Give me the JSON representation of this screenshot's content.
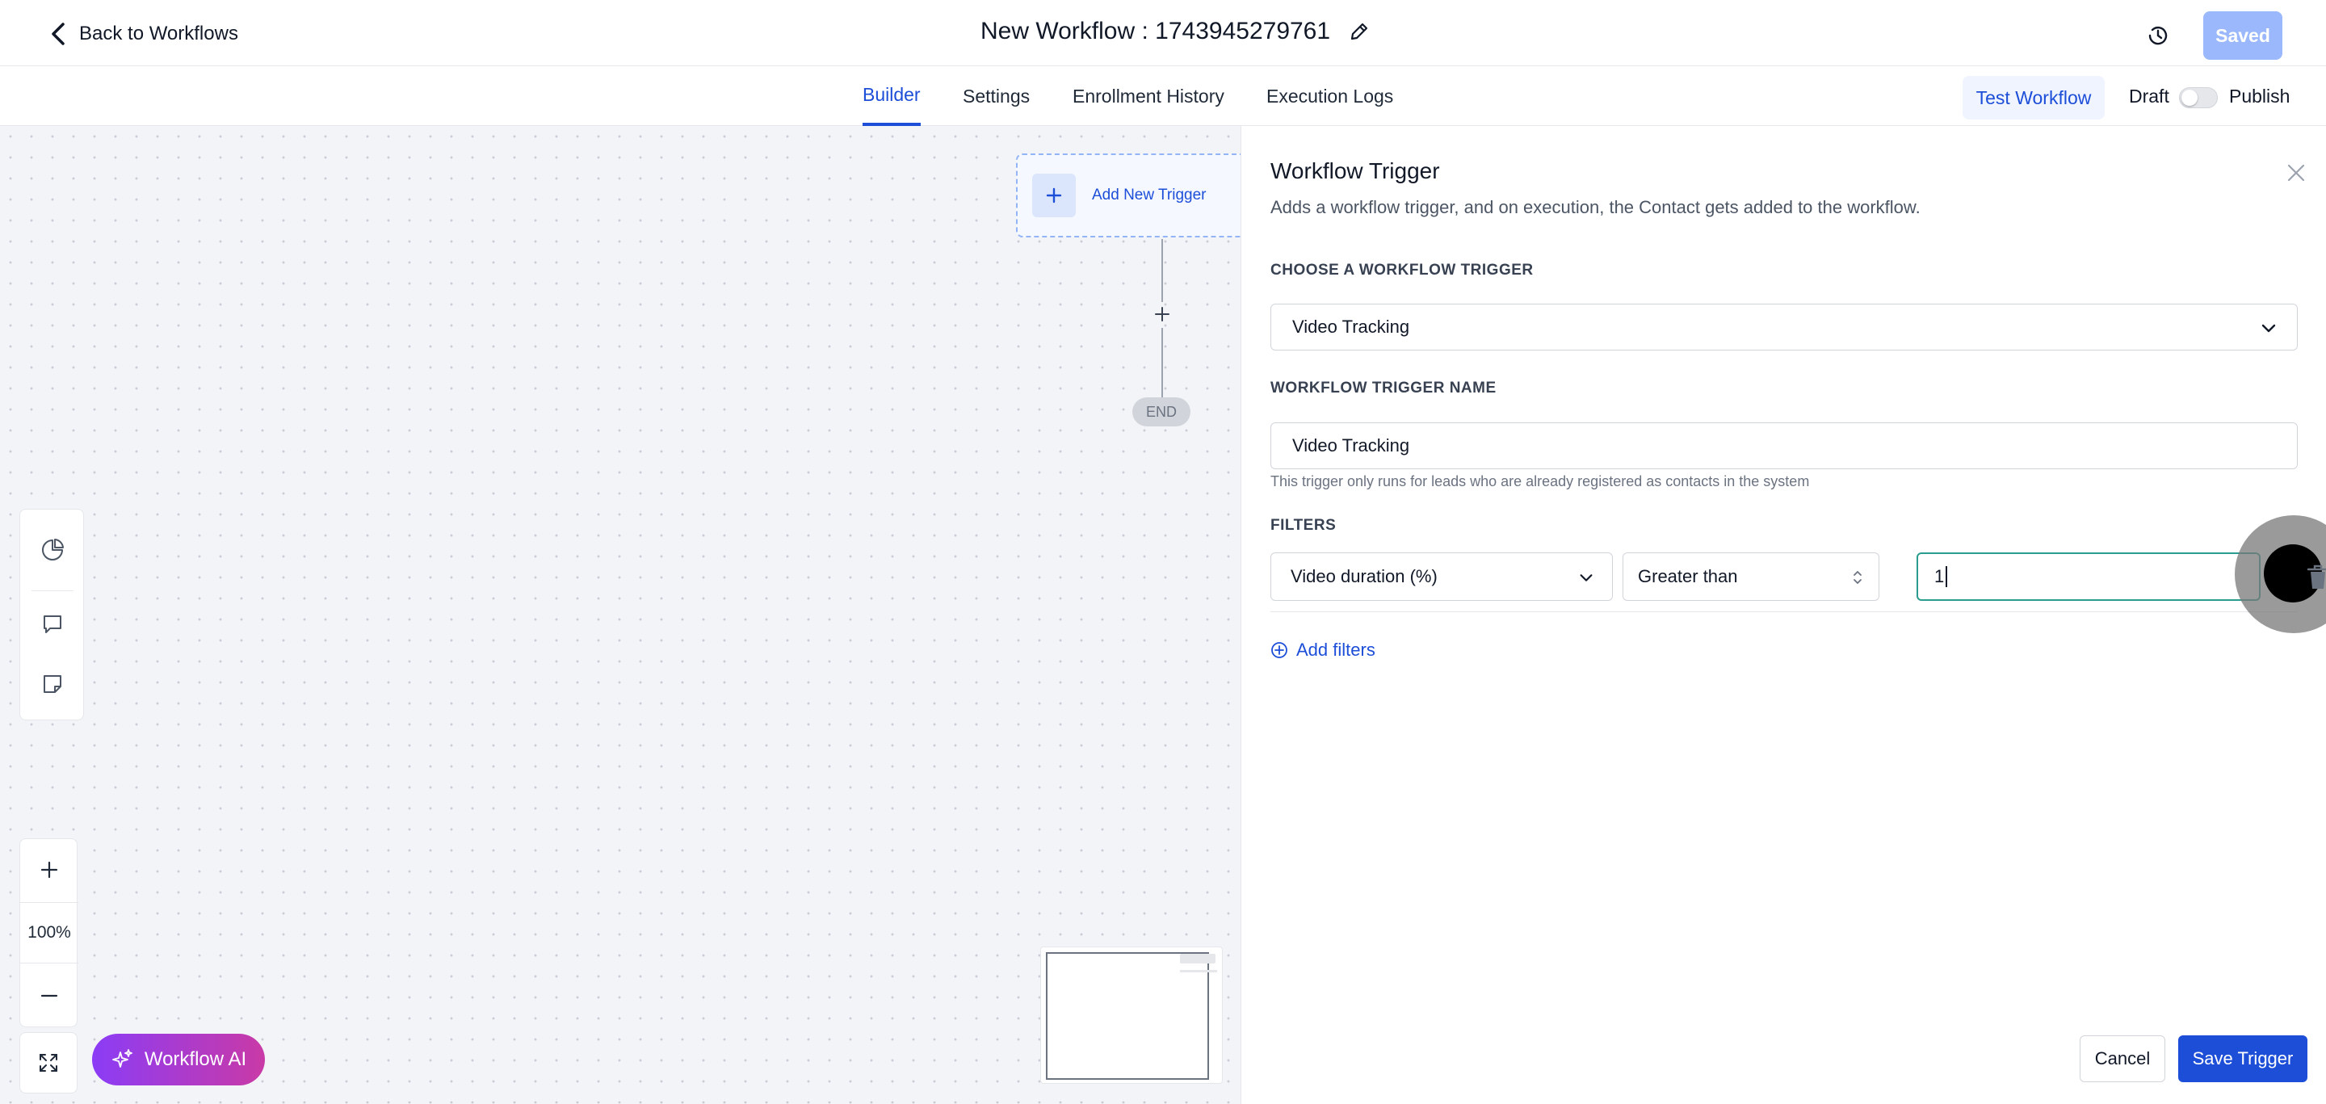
{
  "header": {
    "back_label": "Back to Workflows",
    "title": "New Workflow : 1743945279761",
    "saved_label": "Saved"
  },
  "tabs": [
    {
      "label": "Builder",
      "active": true
    },
    {
      "label": "Settings",
      "active": false
    },
    {
      "label": "Enrollment History",
      "active": false
    },
    {
      "label": "Execution Logs",
      "active": false
    }
  ],
  "actions": {
    "test_label": "Test Workflow",
    "draft_label": "Draft",
    "publish_label": "Publish",
    "publish_on": false
  },
  "canvas": {
    "add_trigger_label": "Add New Trigger",
    "end_label": "END",
    "zoom": "100%",
    "ai_label": "Workflow AI"
  },
  "drawer": {
    "title": "Workflow Trigger",
    "subtitle": "Adds a workflow trigger, and on execution, the Contact gets added to the workflow.",
    "choose_label": "CHOOSE A WORKFLOW TRIGGER",
    "trigger_value": "Video Tracking",
    "name_label": "WORKFLOW TRIGGER NAME",
    "name_value": "Video Tracking",
    "helper": "This trigger only runs for leads who are already registered as contacts in the system",
    "filters_label": "FILTERS",
    "filter": {
      "field": "Video duration (%)",
      "operator": "Greater than",
      "value": "1"
    },
    "add_filters_label": "Add filters",
    "cancel_label": "Cancel",
    "save_label": "Save Trigger"
  },
  "colors": {
    "primary": "#1d4ed8",
    "saved_bg": "#9ab8fb",
    "input_focus": "#2a9d8f"
  }
}
